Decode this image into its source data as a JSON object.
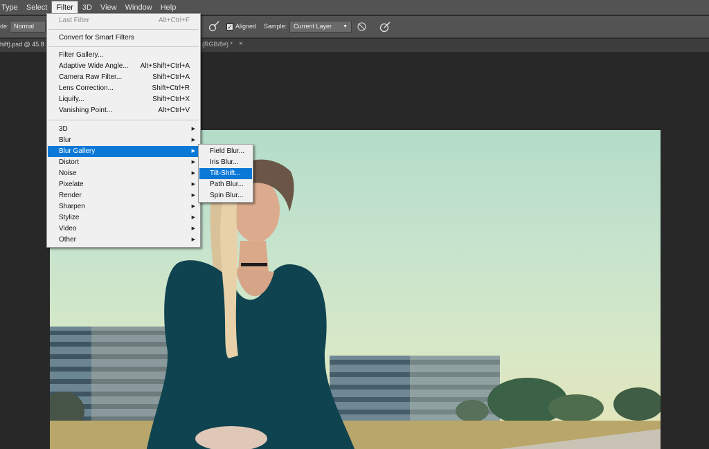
{
  "menubar": {
    "items": [
      "Type",
      "Select",
      "Filter",
      "3D",
      "View",
      "Window",
      "Help"
    ],
    "active": "Filter"
  },
  "options": {
    "mode_label": "de:",
    "mode_value": "Normal",
    "aligned_label": "Aligned",
    "aligned_checked": true,
    "sample_label": "Sample:",
    "sample_value": "Current Layer",
    "icons": [
      "brush-settings-icon",
      "ignore-adjustment-icon",
      "pressure-size-icon"
    ]
  },
  "document": {
    "tab_left": "hift).psd @ 45.8",
    "tab_right": "(RGB/8#) *",
    "close": "×"
  },
  "filter_menu": {
    "last_filter": {
      "label": "Last Filter",
      "shortcut": "Alt+Ctrl+F"
    },
    "convert": "Convert for Smart Filters",
    "group1": [
      {
        "label": "Filter Gallery...",
        "shortcut": ""
      },
      {
        "label": "Adaptive Wide Angle...",
        "shortcut": "Alt+Shift+Ctrl+A"
      },
      {
        "label": "Camera Raw Filter...",
        "shortcut": "Shift+Ctrl+A"
      },
      {
        "label": "Lens Correction...",
        "shortcut": "Shift+Ctrl+R"
      },
      {
        "label": "Liquify...",
        "shortcut": "Shift+Ctrl+X"
      },
      {
        "label": "Vanishing Point...",
        "shortcut": "Alt+Ctrl+V"
      }
    ],
    "group2": [
      "3D",
      "Blur",
      "Blur Gallery",
      "Distort",
      "Noise",
      "Pixelate",
      "Render",
      "Sharpen",
      "Stylize",
      "Video",
      "Other"
    ],
    "highlighted": "Blur Gallery"
  },
  "blur_gallery_submenu": {
    "items": [
      "Field Blur...",
      "Iris Blur...",
      "Tilt-Shift...",
      "Path Blur...",
      "Spin Blur..."
    ],
    "highlighted": "Tilt-Shift..."
  },
  "colors": {
    "menu_highlight": "#0a78d7",
    "app_chrome": "#535353",
    "workspace": "#282828"
  }
}
